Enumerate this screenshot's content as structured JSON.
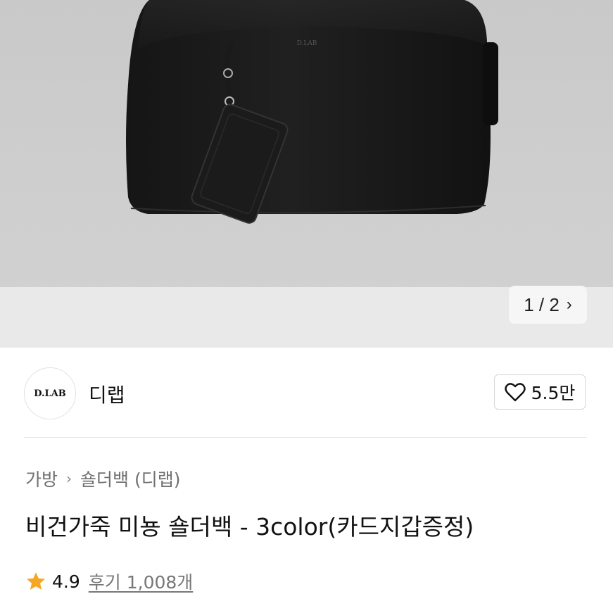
{
  "gallery": {
    "current": "1",
    "total": "2",
    "separator": " / ",
    "bag_logo_text": "D.LAB"
  },
  "seller": {
    "logo_text": "D.LAB",
    "name": "디랩",
    "likes": "5.5만"
  },
  "breadcrumb": {
    "items": [
      "가방",
      "숄더백 (디랩)"
    ]
  },
  "product": {
    "title": "비건가죽 미뇽 숄더백 - 3color(카드지갑증정)",
    "rating": "4.9",
    "reviews": "후기 1,008개"
  },
  "colors": {
    "star": "#f5a623",
    "text": "#111111",
    "muted": "#707070",
    "border": "#d7d7d7"
  },
  "icons": {
    "next": "chevron-right-icon",
    "like": "heart-outline-icon",
    "breadcrumb_sep": "chevron-right-icon",
    "rating": "star-icon"
  }
}
